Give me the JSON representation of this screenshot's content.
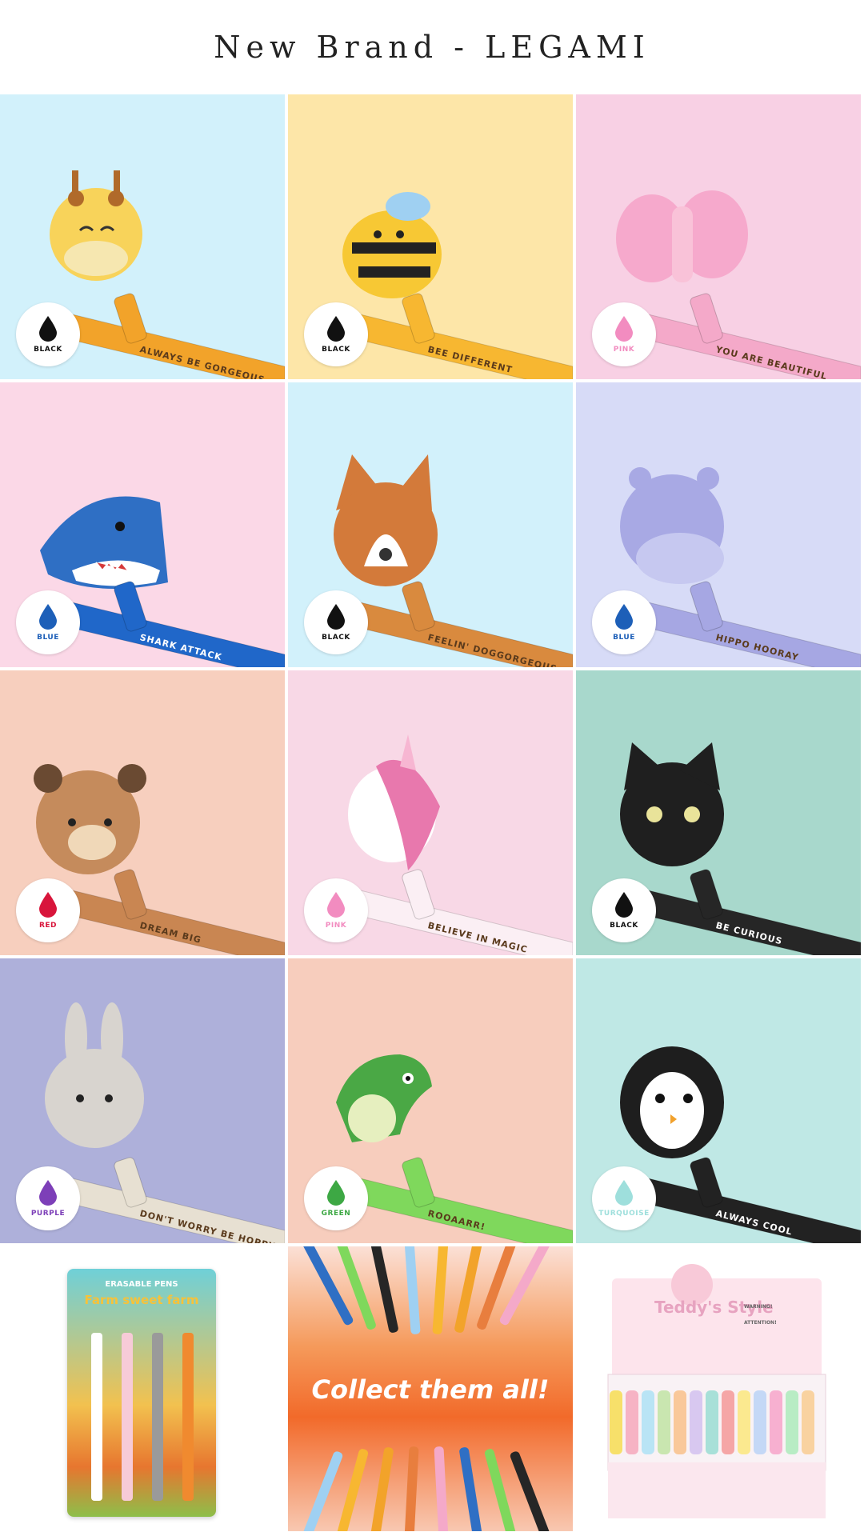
{
  "page": {
    "title": "New Brand - LEGAMI"
  },
  "products": [
    {
      "animal": "giraffe",
      "bg": "#d2f1fb",
      "pen": "#f2a32a",
      "slogan": "ALWAYS BE GORGEOUS",
      "ink_label": "BLACK",
      "ink_color": "#111111",
      "icon": "giraffe-icon"
    },
    {
      "animal": "bee",
      "bg": "#fde6a8",
      "pen": "#f7b731",
      "slogan": "BEE DIFFERENT",
      "ink_label": "BLACK",
      "ink_color": "#111111",
      "icon": "bee-icon"
    },
    {
      "animal": "butterfly",
      "bg": "#f8d0e4",
      "pen": "#f4a9c9",
      "slogan": "YOU ARE BEAUTIFUL",
      "ink_label": "PINK",
      "ink_color": "#f28cc0",
      "icon": "butterfly-icon"
    },
    {
      "animal": "shark",
      "bg": "#fbd8e7",
      "pen": "#2067c9",
      "slogan": "SHARK ATTACK",
      "ink_label": "BLUE",
      "ink_color": "#1d5fb8",
      "icon": "shark-icon"
    },
    {
      "animal": "corgi",
      "bg": "#d2f1fb",
      "pen": "#d98a3e",
      "slogan": "FEELIN' DOGGORGEOUS",
      "ink_label": "BLACK",
      "ink_color": "#111111",
      "icon": "corgi-icon"
    },
    {
      "animal": "hippo",
      "bg": "#d7dbf7",
      "pen": "#a6a7e3",
      "slogan": "HIPPO HOORAY",
      "ink_label": "BLUE",
      "ink_color": "#1d5fb8",
      "icon": "hippo-icon"
    },
    {
      "animal": "bear",
      "bg": "#f7cfbe",
      "pen": "#c98652",
      "slogan": "DREAM BIG",
      "ink_label": "RED",
      "ink_color": "#d8153b",
      "icon": "bear-icon"
    },
    {
      "animal": "unicorn",
      "bg": "#f8d8e6",
      "pen": "#fbeff4",
      "slogan": "BELIEVE IN MAGIC",
      "ink_label": "PINK",
      "ink_color": "#f28cc0",
      "icon": "unicorn-icon"
    },
    {
      "animal": "cat",
      "bg": "#a8d8cc",
      "pen": "#262626",
      "slogan": "BE CURIOUS",
      "ink_label": "BLACK",
      "ink_color": "#111111",
      "icon": "cat-icon"
    },
    {
      "animal": "bunny",
      "bg": "#aeb0da",
      "pen": "#e7e0d2",
      "slogan": "DON'T WORRY BE HOPPY",
      "ink_label": "PURPLE",
      "ink_color": "#7d3fb8",
      "icon": "bunny-icon"
    },
    {
      "animal": "dino",
      "bg": "#f7cdbd",
      "pen": "#7fd85c",
      "slogan": "ROOAARR!",
      "ink_label": "GREEN",
      "ink_color": "#3da844",
      "icon": "dinosaur-icon"
    },
    {
      "animal": "penguin",
      "bg": "#bfe8e5",
      "pen": "#222222",
      "slogan": "ALWAYS COOL",
      "ink_label": "TURQUOISE",
      "ink_color": "#9edfdc",
      "icon": "penguin-icon"
    }
  ],
  "promo": {
    "pack": {
      "title": "ERASABLE PENS",
      "subtitle": "Farm sweet farm"
    },
    "collect": {
      "text": "Collect them all!"
    },
    "display": {
      "title": "Teddy's Style",
      "warning": "WARNING!",
      "attention": "ATTENTION!"
    }
  }
}
